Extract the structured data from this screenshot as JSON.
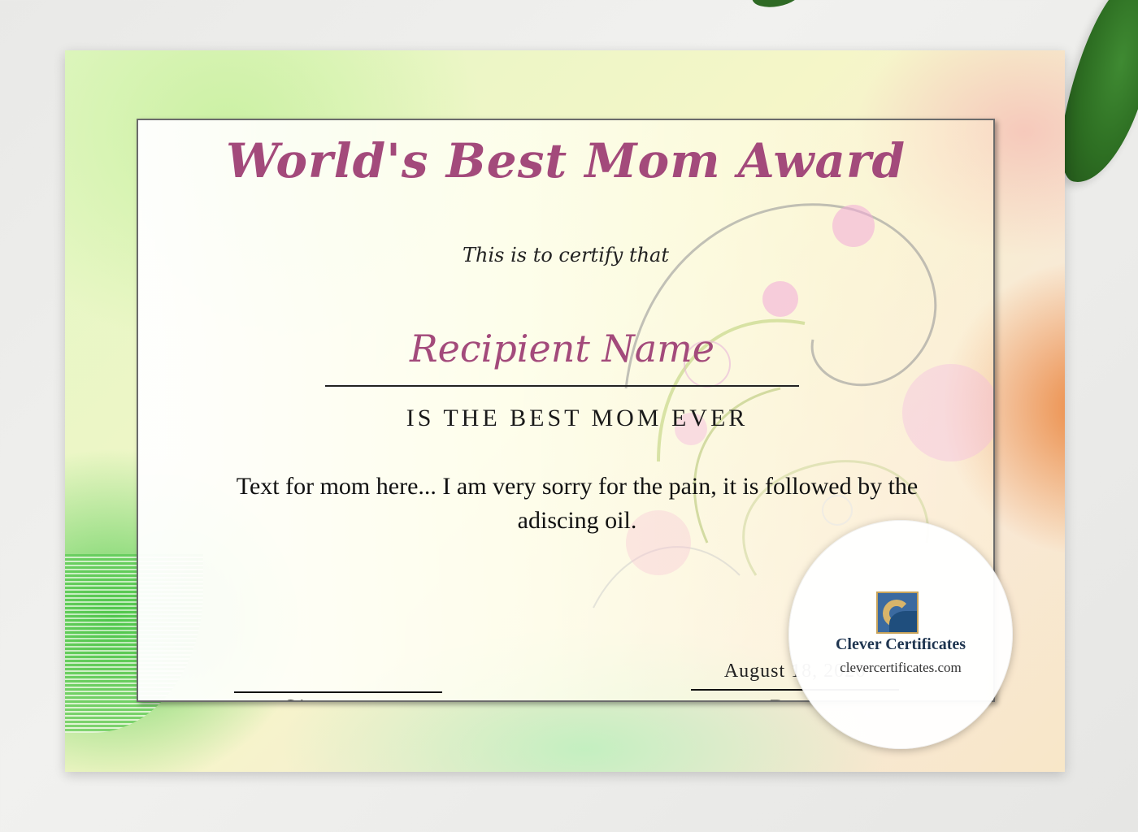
{
  "certificate": {
    "title": "World's Best Mom Award",
    "intro": "This is to certify that",
    "recipient": "Recipient Name",
    "subtitle": "IS THE BEST MOM EVER",
    "message": "Text for mom here... I am very sorry for the pain, it is followed by the adiscing oil.",
    "signature_label": "Signature",
    "date_value": "August 18, 2026",
    "date_label": "Date"
  },
  "brand": {
    "name": "Clever Certificates",
    "url": "clevercertificates.com"
  },
  "colors": {
    "title": "#a34a7b",
    "text": "#111111",
    "logo_blue": "#3b6aa0",
    "logo_gold": "#d8b46a"
  }
}
